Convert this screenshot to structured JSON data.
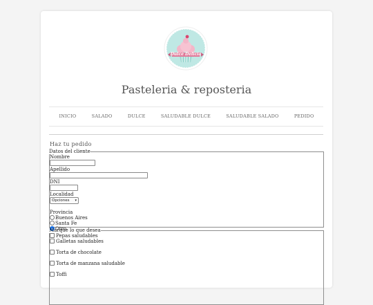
{
  "logo": {
    "text": "Dulce Delicia"
  },
  "site_title": "Pasteleria & reposteria",
  "nav": [
    "INICIO",
    "SALADO",
    "DULCE",
    "SALUDABLE DULCE",
    "SALUDABLE SALADO",
    "PEDIDO"
  ],
  "form": {
    "heading": "Haz tu pedido",
    "client": {
      "legend": "Datos del cliente",
      "nombre_label": "Nombre",
      "apellido_label": "Apellido",
      "dni_label": "DNI",
      "localidad_label": "Localidad",
      "localidad_selected": "Opciones",
      "provincia_label": "Provincia",
      "provincias": [
        {
          "label": "Buenos Aires",
          "checked": false
        },
        {
          "label": "Santa Fe",
          "checked": false
        },
        {
          "label": "Otro",
          "checked": true
        }
      ]
    },
    "order": {
      "legend": "Marque lo que desea",
      "items": [
        "Pepas saludables",
        "Galletas saludables",
        "Torta de chocolate",
        "Torta de manzana saludable",
        "Toffi"
      ]
    }
  },
  "colors": {
    "logo_mint": "#bfe8e4",
    "logo_pink": "#e07a9a",
    "logo_frosting": "#f4b6c8",
    "radio_checked": "#1a73e8"
  }
}
